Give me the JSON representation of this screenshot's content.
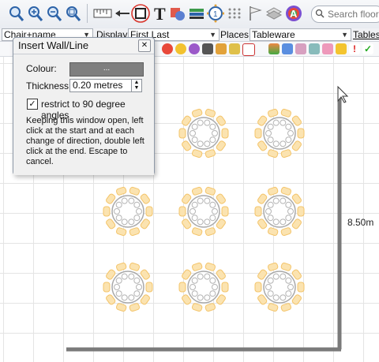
{
  "toolbar": {
    "search_placeholder": "Search floor pl"
  },
  "row2": {
    "chairs_value": "Chair+name",
    "display_label": "Display:",
    "display_value": "First Last",
    "places_label": "Places:",
    "places_value": "Tableware",
    "tables_label": "Tables"
  },
  "dialog": {
    "title": "Insert Wall/Line",
    "colour_label": "Colour:",
    "colour_button": "...",
    "colour_value": "#7f7f7f",
    "thickness_label": "Thickness:",
    "thickness_value": "0.20 metres",
    "restrict_label": "restrict to 90 degree angles",
    "restrict_checked": true,
    "help_text": "Keeping this window open, left click at the start and at each change of direction, double left click at the end. Escape to cancel."
  },
  "canvas": {
    "dimension_label": "8.50m"
  },
  "colors": {
    "wall": "#7a7a7a",
    "chair": "#f3c46a",
    "highlight_ring": "#d9342b"
  }
}
